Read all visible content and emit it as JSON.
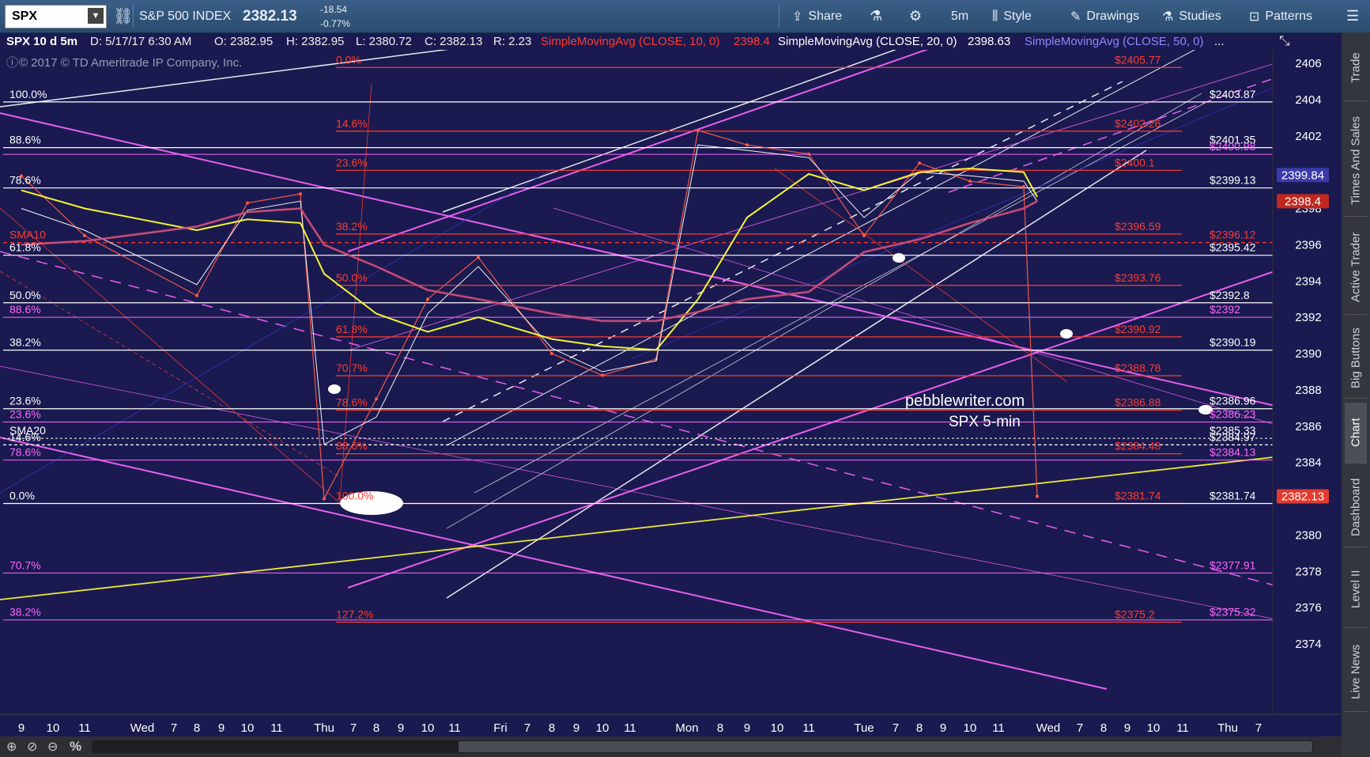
{
  "toolbar": {
    "symbol": "SPX",
    "index_name": "S&P 500 INDEX",
    "price": "2382.13",
    "change": "-18.54",
    "change_pct": "-0.77%",
    "share": "Share",
    "timeframe": "5m",
    "style": "Style",
    "drawings": "Drawings",
    "studies": "Studies",
    "patterns": "Patterns"
  },
  "info": {
    "period": "SPX 10 d 5m",
    "date": "D: 5/17/17 6:30 AM",
    "open": "O: 2382.95",
    "high": "H: 2382.95",
    "low": "L: 2380.72",
    "close": "C: 2382.13",
    "range": "R: 2.23",
    "sma10_label": "SimpleMovingAvg (CLOSE, 10, 0)",
    "sma10_value": "2398.4",
    "sma20_label": "SimpleMovingAvg (CLOSE, 20, 0)",
    "sma20_value": "2398.63",
    "sma50_label": "SimpleMovingAvg (CLOSE, 50, 0)",
    "ellipsis": "..."
  },
  "copyright": "© 2017 © TD Ameritrade IP Company, Inc.",
  "watermark": [
    "pebblewriter.com",
    "SPX 5-min"
  ],
  "right_tabs": [
    "Trade",
    "Times And Sales",
    "Active Trader",
    "Big Buttons",
    "Chart",
    "Dashboard",
    "Level II",
    "Live News"
  ],
  "colors": {
    "background": "#1a1a50",
    "fib": "#ff3b30",
    "white_level": "#ffffff",
    "magenta": "#ff66ff",
    "yellow": "#ffff33",
    "blue": "#7070ff",
    "price_badge": "#e33b2e"
  },
  "chart_data": {
    "type": "line",
    "title": "",
    "ylim": [
      2373.5,
      2407
    ],
    "yticks": [
      2374,
      2376,
      2378,
      2380,
      2382,
      2384,
      2386,
      2388,
      2390,
      2392,
      2394,
      2396,
      2398,
      2400,
      2402,
      2404,
      2406
    ],
    "xticks": [
      "9",
      "10",
      "11",
      "Wed",
      "7",
      "8",
      "9",
      "10",
      "11",
      "Thu",
      "7",
      "8",
      "9",
      "10",
      "11",
      "Fri",
      "7",
      "8",
      "9",
      "10",
      "11",
      "Mon",
      "8",
      "9",
      "10",
      "11",
      "Tue",
      "7",
      "8",
      "9",
      "10",
      "11",
      "Wed",
      "7",
      "8",
      "9",
      "10",
      "11",
      "Thu",
      "7"
    ],
    "grid": false,
    "series": [
      {
        "name": "SPX",
        "x": [
          "Tue 9:00",
          "Tue 11:00",
          "Wed 8:00",
          "Wed 10:00",
          "Wed 12:00",
          "Thu 6:30",
          "Thu 8:00",
          "Thu 10:00",
          "Thu 12:00",
          "Fri 8:00",
          "Fri 10:00",
          "Fri 12:00",
          "Mon 7:00",
          "Mon 9:00",
          "Mon 11:00",
          "Tue 6:30",
          "Tue 8:00",
          "Tue 10:00",
          "Tue 12:00",
          "Wed 6:30"
        ],
        "values": [
          2399.8,
          2396.5,
          2393.2,
          2398.3,
          2398.8,
          2382.0,
          2387.5,
          2393.0,
          2395.3,
          2390.0,
          2388.8,
          2389.7,
          2402.3,
          2401.5,
          2401.0,
          2396.5,
          2400.5,
          2399.5,
          2399.2,
          2382.13
        ]
      },
      {
        "name": "SMA10",
        "values": [
          2398.0,
          2396.8,
          2393.8,
          2397.9,
          2398.4,
          2385.0,
          2386.5,
          2392.2,
          2394.8,
          2390.3,
          2389.0,
          2389.6,
          2401.5,
          2401.2,
          2400.8,
          2397.5,
          2400.0,
          2399.8,
          2399.5,
          2398.4
        ]
      },
      {
        "name": "SMA20",
        "values": [
          2399.0,
          2398.0,
          2396.8,
          2397.4,
          2397.2,
          2394.4,
          2392.2,
          2391.2,
          2392.0,
          2390.8,
          2390.4,
          2390.2,
          2393.0,
          2397.5,
          2399.9,
          2399.0,
          2400.0,
          2400.2,
          2400.0,
          2398.63
        ]
      },
      {
        "name": "SMA50",
        "values": [
          2396.0,
          2396.2,
          2397.0,
          2397.8,
          2398.0,
          2396.0,
          2394.8,
          2393.5,
          2393.0,
          2392.2,
          2391.8,
          2391.8,
          2392.3,
          2393.0,
          2393.4,
          2395.6,
          2396.3,
          2397.2,
          2398.0,
          2398.4
        ]
      }
    ],
    "fib_levels": [
      {
        "pct": "0.0%",
        "value": "$2405.77",
        "y": 2405.77
      },
      {
        "pct": "14.6%",
        "value": "$2402.26",
        "y": 2402.26
      },
      {
        "pct": "23.6%",
        "value": "$2400.1",
        "y": 2400.1
      },
      {
        "pct": "38.2%",
        "value": "$2396.59",
        "y": 2396.59
      },
      {
        "pct": "50.0%",
        "value": "$2393.76",
        "y": 2393.76
      },
      {
        "pct": "61.8%",
        "value": "$2390.92",
        "y": 2390.92
      },
      {
        "pct": "70.7%",
        "value": "$2388.78",
        "y": 2388.78
      },
      {
        "pct": "78.6%",
        "value": "$2386.88",
        "y": 2386.88
      },
      {
        "pct": "88.6%",
        "value": "$2384.48",
        "y": 2384.48
      },
      {
        "pct": "100.0%",
        "value": "$2381.74",
        "y": 2381.74
      },
      {
        "pct": "127.2%",
        "value": "$2375.2",
        "y": 2375.2
      }
    ],
    "white_levels": [
      {
        "pct": "100.0%",
        "value": "$2403.87",
        "y": 2403.87
      },
      {
        "pct": "88.6%",
        "value": "$2401.35",
        "y": 2401.35
      },
      {
        "pct": "78.6%",
        "value": "$2399.13",
        "y": 2399.13
      },
      {
        "pct": "61.8%",
        "value": "$2395.42",
        "y": 2395.42
      },
      {
        "pct": "50.0%",
        "value": "$2392.8",
        "y": 2392.8
      },
      {
        "pct": "38.2%",
        "value": "$2390.19",
        "y": 2390.19
      },
      {
        "pct": "23.6%",
        "value": "$2386.96",
        "y": 2386.96
      },
      {
        "pct": "14.6%",
        "value": "$2384.97",
        "y": 2384.97
      },
      {
        "pct": "0.0%",
        "value": "$2381.74",
        "y": 2381.74
      }
    ],
    "magenta_levels": [
      {
        "pct": "",
        "value": "$2400.98",
        "y": 2400.98
      },
      {
        "pct": "88.6%",
        "value": "$2392",
        "y": 2392.0
      },
      {
        "pct": "23.6%",
        "value": "$2386.23",
        "y": 2386.23
      },
      {
        "pct": "78.6%",
        "value": "$2384.13",
        "y": 2384.13
      },
      {
        "pct": "70.7%",
        "value": "$2377.91",
        "y": 2377.91
      },
      {
        "pct": "38.2%",
        "value": "$2375.32",
        "y": 2375.32
      }
    ],
    "other_labels": [
      {
        "text": "$2396.12",
        "y": 2396.12
      },
      {
        "text": "$2385.33",
        "y": 2385.33
      },
      {
        "text": "SMA10",
        "y": 2396.12
      },
      {
        "text": "SMA20",
        "y": 2385.33
      }
    ],
    "badges": [
      {
        "text": "2399.84",
        "y": 2399.84,
        "color": "#3a3aa8"
      },
      {
        "text": "2398.4",
        "y": 2398.4,
        "color": "#c0281e"
      },
      {
        "text": "2382.13",
        "y": 2382.13,
        "color": "#e33b2e"
      }
    ]
  }
}
